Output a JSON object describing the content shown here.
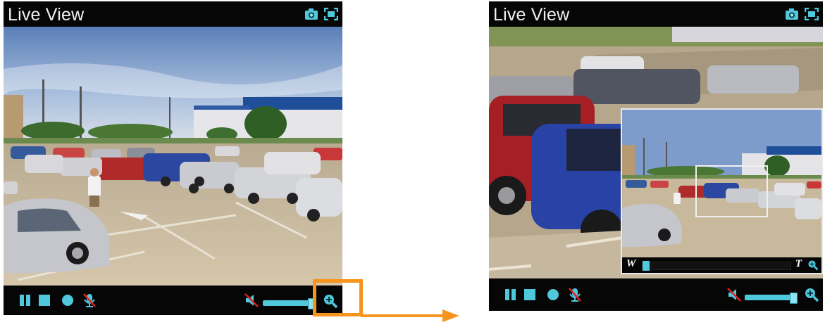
{
  "left_panel": {
    "title": "Live View",
    "icons": [
      "camera-snapshot-icon",
      "fullscreen-icon"
    ],
    "controls": [
      "pause-icon",
      "stop-icon",
      "record-icon",
      "mic-muted-icon"
    ],
    "volume_icon": "speaker-muted-icon",
    "zoom_icon": "zoom-in-icon"
  },
  "right_panel": {
    "title": "Live View",
    "icons": [
      "camera-snapshot-icon",
      "fullscreen-icon"
    ],
    "controls": [
      "pause-icon",
      "stop-icon",
      "record-icon",
      "mic-muted-icon"
    ],
    "volume_icon": "speaker-muted-icon",
    "zoom_icon": "zoom-in-icon",
    "pip": {
      "wide_label": "W",
      "tele_label": "T"
    }
  },
  "colors": {
    "accent_cyan": "#4fc8dc",
    "highlight_orange": "#f7941d",
    "bar_black": "#060606"
  }
}
